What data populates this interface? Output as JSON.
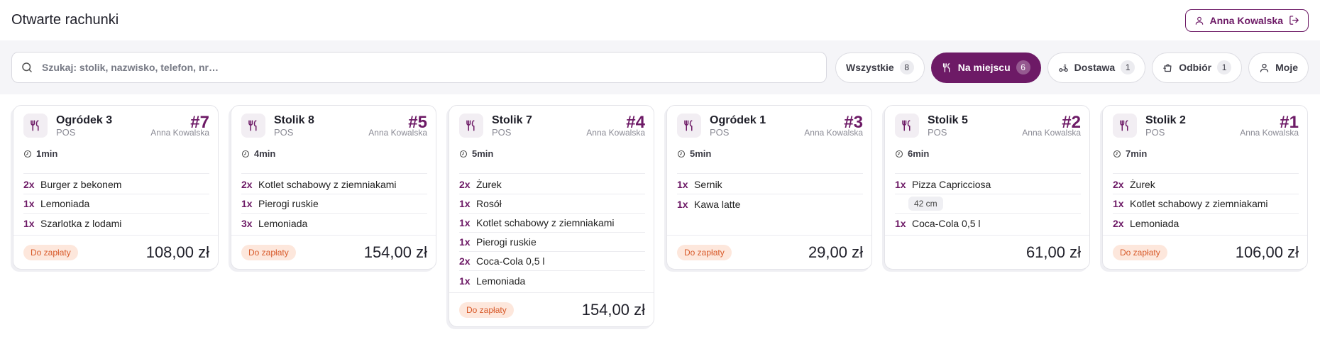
{
  "header": {
    "title": "Otwarte rachunki",
    "user_name": "Anna Kowalska"
  },
  "search": {
    "placeholder": "Szukaj: stolik, nazwisko, telefon, nr…",
    "value": ""
  },
  "filters": [
    {
      "label": "Wszystkie",
      "count": "8",
      "icon": "none",
      "active": false
    },
    {
      "label": "Na miejscu",
      "count": "6",
      "icon": "cutlery-icon",
      "active": true
    },
    {
      "label": "Dostawa",
      "count": "1",
      "icon": "scooter-icon",
      "active": false
    },
    {
      "label": "Odbiór",
      "count": "1",
      "icon": "takeaway-icon",
      "active": false
    },
    {
      "label": "Moje",
      "count": "",
      "icon": "user-icon",
      "active": false
    }
  ],
  "colors": {
    "accent": "#6d1a66",
    "badge_text": "#d85a2a",
    "badge_bg": "#fde7dc"
  },
  "orders": [
    {
      "table": "Ogródek 3",
      "source": "POS",
      "number": "#7",
      "waiter": "Anna Kowalska",
      "time": "1min",
      "items": [
        {
          "qty": "2x",
          "name": "Burger z bekonem"
        },
        {
          "qty": "1x",
          "name": "Lemoniada"
        },
        {
          "qty": "1x",
          "name": "Szarlotka z lodami"
        }
      ],
      "status": "Do zapłaty",
      "total": "108,00 zł"
    },
    {
      "table": "Stolik 8",
      "source": "POS",
      "number": "#5",
      "waiter": "Anna Kowalska",
      "time": "4min",
      "items": [
        {
          "qty": "2x",
          "name": "Kotlet schabowy z ziemniakami"
        },
        {
          "qty": "1x",
          "name": "Pierogi ruskie"
        },
        {
          "qty": "3x",
          "name": "Lemoniada"
        }
      ],
      "status": "Do zapłaty",
      "total": "154,00 zł"
    },
    {
      "table": "Stolik 7",
      "source": "POS",
      "number": "#4",
      "waiter": "Anna Kowalska",
      "time": "5min",
      "items": [
        {
          "qty": "2x",
          "name": "Żurek"
        },
        {
          "qty": "1x",
          "name": "Rosół"
        },
        {
          "qty": "1x",
          "name": "Kotlet schabowy z ziemniakami"
        },
        {
          "qty": "1x",
          "name": "Pierogi ruskie"
        },
        {
          "qty": "2x",
          "name": "Coca-Cola 0,5 l"
        },
        {
          "qty": "1x",
          "name": "Lemoniada"
        }
      ],
      "status": "Do zapłaty",
      "total": "154,00 zł"
    },
    {
      "table": "Ogródek 1",
      "source": "POS",
      "number": "#3",
      "waiter": "Anna Kowalska",
      "time": "5min",
      "items": [
        {
          "qty": "1x",
          "name": "Sernik"
        },
        {
          "qty": "1x",
          "name": "Kawa latte"
        }
      ],
      "status": "Do zapłaty",
      "total": "29,00 zł"
    },
    {
      "table": "Stolik 5",
      "source": "POS",
      "number": "#2",
      "waiter": "Anna Kowalska",
      "time": "6min",
      "items": [
        {
          "qty": "1x",
          "name": "Pizza Capricciosa",
          "modifier": "42 cm"
        },
        {
          "qty": "1x",
          "name": "Coca-Cola 0,5 l"
        }
      ],
      "status": "",
      "total": "61,00 zł"
    },
    {
      "table": "Stolik 2",
      "source": "POS",
      "number": "#1",
      "waiter": "Anna Kowalska",
      "time": "7min",
      "items": [
        {
          "qty": "2x",
          "name": "Żurek"
        },
        {
          "qty": "1x",
          "name": "Kotlet schabowy z ziemniakami"
        },
        {
          "qty": "2x",
          "name": "Lemoniada"
        }
      ],
      "status": "Do zapłaty",
      "total": "106,00 zł"
    }
  ]
}
